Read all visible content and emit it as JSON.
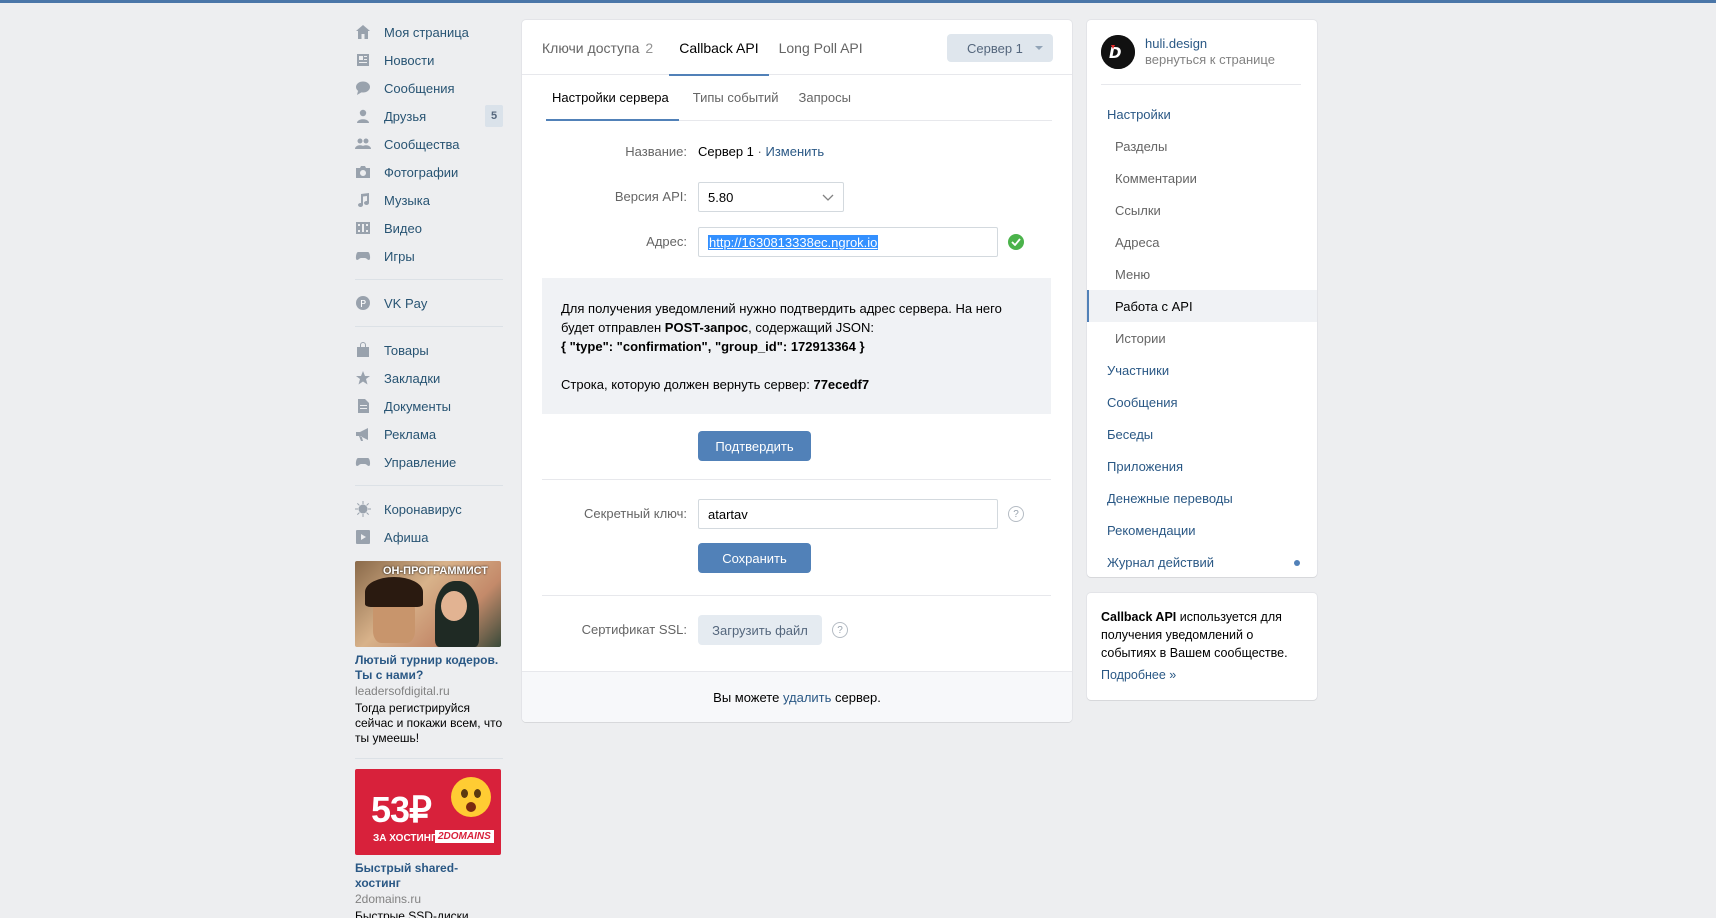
{
  "left_nav": {
    "items": [
      {
        "label": "Моя страница",
        "icon": "home-icon"
      },
      {
        "label": "Новости",
        "icon": "news-icon"
      },
      {
        "label": "Сообщения",
        "icon": "messages-icon"
      },
      {
        "label": "Друзья",
        "icon": "friends-icon",
        "badge": "5"
      },
      {
        "label": "Сообщества",
        "icon": "groups-icon"
      },
      {
        "label": "Фотографии",
        "icon": "camera-icon"
      },
      {
        "label": "Музыка",
        "icon": "music-icon"
      },
      {
        "label": "Видео",
        "icon": "video-icon"
      },
      {
        "label": "Игры",
        "icon": "games-icon"
      }
    ],
    "pay": {
      "label": "VK Pay",
      "icon": "vkpay-icon"
    },
    "items2": [
      {
        "label": "Товары",
        "icon": "bag-icon"
      },
      {
        "label": "Закладки",
        "icon": "star-icon"
      },
      {
        "label": "Документы",
        "icon": "document-icon"
      },
      {
        "label": "Реклама",
        "icon": "megaphone-icon"
      },
      {
        "label": "Управление",
        "icon": "gamepad-icon"
      }
    ],
    "items3": [
      {
        "label": "Коронавирус",
        "icon": "virus-icon"
      },
      {
        "label": "Афиша",
        "icon": "play-icon"
      }
    ]
  },
  "ads": [
    {
      "image_caption": "ОН-ПРОГРАММИСТ",
      "title": "Лютый турнир кодеров. Ты с нами?",
      "domain": "leadersofdigital.ru",
      "text": "Тогда регистрируйся сейчас и покажи всем, что ты умеешь!"
    },
    {
      "image_price": "53₽",
      "image_caption": "ЗА ХОСТИНГ",
      "image_brand": "2DOMAINS",
      "title": "Быстрый shared-хостинг",
      "domain": "2domains.ru",
      "text": "Быстрые SSD-диски,"
    }
  ],
  "main": {
    "tabs": [
      {
        "label": "Ключи доступа",
        "count": "2"
      },
      {
        "label": "Callback API"
      },
      {
        "label": "Long Poll API"
      }
    ],
    "server_select": "Сервер 1",
    "sub_tabs": [
      "Настройки сервера",
      "Типы событий",
      "Запросы"
    ],
    "form": {
      "name_label": "Название:",
      "name_value": "Сервер 1",
      "name_sep": " · ",
      "name_edit": "Изменить",
      "api_label": "Версия API:",
      "api_value": "5.80",
      "address_label": "Адрес:",
      "address_value": "http://1630813338ec.ngrok.io",
      "secret_label": "Секретный ключ:",
      "secret_value": "atartav",
      "ssl_label": "Сертификат SSL:",
      "ssl_button": "Загрузить файл"
    },
    "info": {
      "line1": "Для получения уведомлений нужно подтвердить адрес сервера. На него",
      "line2_pre": "будет отправлен ",
      "line2_bold": "POST-запрос",
      "line2_post": ", содержащий JSON:",
      "json": "{ \"type\": \"confirmation\", \"group_id\": 172913364 }",
      "return_pre": "Строка, которую должен вернуть сервер: ",
      "return_value": "77ecedf7"
    },
    "confirm_button": "Подтвердить",
    "save_button": "Сохранить",
    "footer_pre": "Вы можете ",
    "footer_link": "удалить",
    "footer_post": " сервер."
  },
  "right_menu": {
    "owner_name": "huli.design",
    "owner_back": "вернуться к странице",
    "items": [
      {
        "label": "Настройки",
        "sub": false
      },
      {
        "label": "Разделы",
        "sub": true
      },
      {
        "label": "Комментарии",
        "sub": true
      },
      {
        "label": "Ссылки",
        "sub": true
      },
      {
        "label": "Адреса",
        "sub": true
      },
      {
        "label": "Меню",
        "sub": true
      },
      {
        "label": "Работа с API",
        "sub": true,
        "active": true
      },
      {
        "label": "Истории",
        "sub": true
      },
      {
        "label": "Участники",
        "sub": false
      },
      {
        "label": "Сообщения",
        "sub": false
      },
      {
        "label": "Беседы",
        "sub": false
      },
      {
        "label": "Приложения",
        "sub": false
      },
      {
        "label": "Денежные переводы",
        "sub": false
      },
      {
        "label": "Рекомендации",
        "sub": false
      },
      {
        "label": "Журнал действий",
        "sub": false,
        "dot": true
      }
    ]
  },
  "right_info": {
    "bold": "Callback API",
    "text": " используется для получения уведомлений о событиях в Вашем сообществе.",
    "more": "Подробнее »"
  },
  "colors": {
    "accent": "#5181b8",
    "link": "#2a5885",
    "background": "#edeef0",
    "success": "#4bb34b"
  }
}
